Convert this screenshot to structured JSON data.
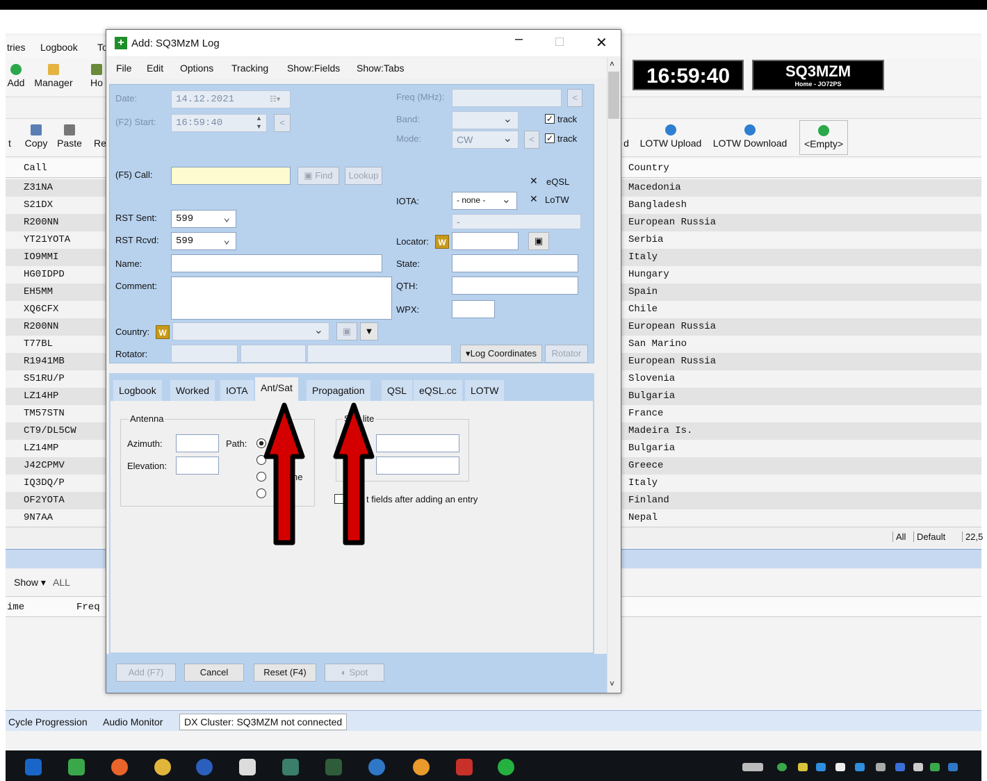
{
  "main": {
    "menu": [
      "tries",
      "Logbook",
      "To"
    ],
    "toolbar1": [
      "Add",
      "Manager",
      "Ho"
    ],
    "clock": "16:59:40",
    "callsign": "SQ3MZM",
    "callsign_sub": "Home - JO72PS",
    "toolbar2": [
      "t",
      "Copy",
      "Paste",
      "Re"
    ],
    "toolbar2_right": [
      "d",
      "LOTW Upload",
      "LOTW Download",
      "<Empty>"
    ],
    "grid_headers": {
      "call": "Call",
      "country": "Country"
    },
    "rows": [
      {
        "call": "Z31NA",
        "country": "Macedonia"
      },
      {
        "call": "S21DX",
        "country": "Bangladesh"
      },
      {
        "call": "R200NN",
        "country": "European Russia"
      },
      {
        "call": "YT21YOTA",
        "country": "Serbia"
      },
      {
        "call": "IO9MMI",
        "country": "Italy"
      },
      {
        "call": "HG0IDPD",
        "country": "Hungary"
      },
      {
        "call": "EH5MM",
        "country": "Spain"
      },
      {
        "call": "XQ6CFX",
        "country": "Chile"
      },
      {
        "call": "R200NN",
        "country": "European Russia"
      },
      {
        "call": "T77BL",
        "country": "San Marino"
      },
      {
        "call": "R1941MB",
        "country": "European Russia"
      },
      {
        "call": "S51RU/P",
        "country": "Slovenia"
      },
      {
        "call": "LZ14HP",
        "country": "Bulgaria"
      },
      {
        "call": "TM57STN",
        "country": "France"
      },
      {
        "call": "CT9/DL5CW",
        "country": "Madeira Is."
      },
      {
        "call": "LZ14MP",
        "country": "Bulgaria"
      },
      {
        "call": "J42CPMV",
        "country": "Greece"
      },
      {
        "call": "IQ3DQ/P",
        "country": "Italy"
      },
      {
        "call": "OF2YOTA",
        "country": "Finland"
      },
      {
        "call": "9N7AA",
        "country": "Nepal"
      }
    ],
    "grid_footer": [
      "All",
      "Default",
      "22,5"
    ],
    "show_label": "Show",
    "show_value": "ALL",
    "lower_headers": {
      "time": "ime",
      "freq": "Freq"
    },
    "status": [
      "Cycle Progression",
      "Audio Monitor",
      "DX Cluster: SQ3MZM not connected"
    ]
  },
  "dialog": {
    "title": "Add: SQ3MzM Log",
    "menu": [
      "File",
      "Edit",
      "Options",
      "Tracking",
      "Show:Fields",
      "Show:Tabs"
    ],
    "labels": {
      "date": "Date:",
      "start": "(F2) Start:",
      "call": "(F5) Call:",
      "rst_sent": "RST Sent:",
      "rst_rcvd": "RST Rcvd:",
      "name": "Name:",
      "comment": "Comment:",
      "country": "Country:",
      "rotator": "Rotator:",
      "freq": "Freq (MHz):",
      "band": "Band:",
      "mode": "Mode:",
      "iota": "IOTA:",
      "locator": "Locator:",
      "state": "State:",
      "qth": "QTH:",
      "wpx": "WPX:"
    },
    "values": {
      "date": "14.12.2021",
      "start": "16:59:40",
      "rst_sent": "599",
      "rst_rcvd": "599",
      "mode": "CW",
      "iota": "- none -",
      "iota_field": "-"
    },
    "buttons": {
      "find": "Find",
      "lookup": "Lookup",
      "log_coordinates": "Log Coordinates",
      "rotator": "Rotator",
      "add": "Add (F7)",
      "cancel": "Cancel",
      "reset": "Reset (F4)",
      "spot": "Spot"
    },
    "checks": {
      "track1": "track",
      "track2": "track",
      "eqsl": "eQSL",
      "lotw": "LoTW"
    },
    "tabs": [
      "Logbook",
      "Worked",
      "IOTA",
      "Ant/Sat",
      "Propagation",
      "QSL",
      "eQSL.cc",
      "LOTW"
    ],
    "active_tab": "Ant/Sat",
    "antsat": {
      "antenna_group": "Antenna",
      "azimuth": "Azimuth:",
      "elevation": "Elevation:",
      "path": "Path:",
      "radio_partial": "ne",
      "sat_group_partial": "S",
      "sat_group_partial2": "lite",
      "reset_fields_partial": "t fields after adding an entry"
    },
    "arrow_color": "#d40000"
  }
}
